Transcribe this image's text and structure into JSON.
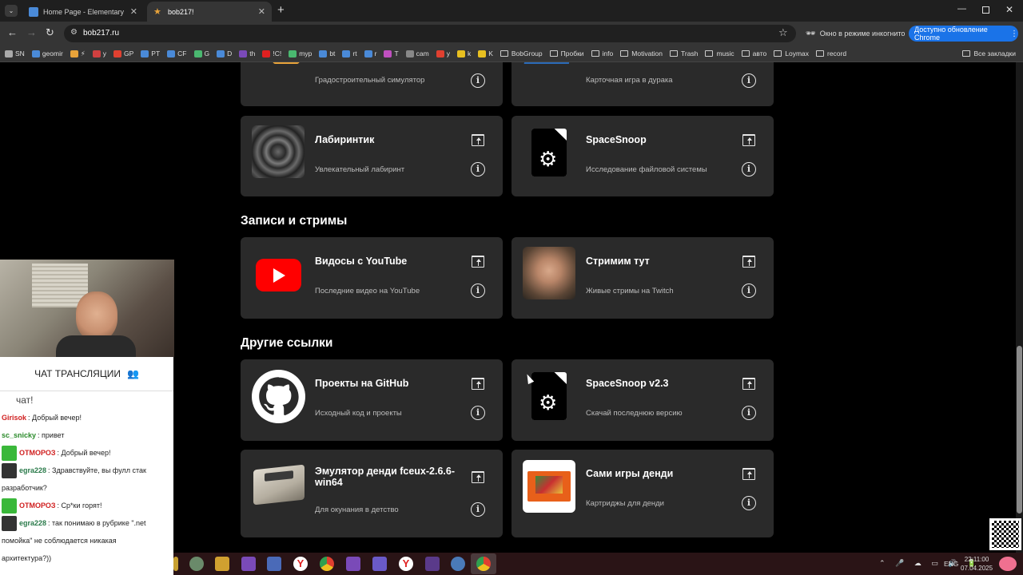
{
  "browser": {
    "tabs": [
      {
        "title": "Home Page - Elementary"
      },
      {
        "title": "bob217!"
      }
    ],
    "url": "bob217.ru",
    "incognito_label": "Окно в режиме инкогнито",
    "update_label": "Доступно обновление Chrome",
    "bookmarks": [
      "SN",
      "geomir",
      "⚡",
      "y",
      "GP",
      "PT",
      "CF",
      "G",
      "D",
      "th",
      "!C!",
      "myp",
      "bt",
      "rt",
      "r",
      "T",
      "cam",
      "y",
      "k",
      "K",
      "BobGroup",
      "Пробки",
      "info",
      "Motivation",
      "Trash",
      "music",
      "авто",
      "Loymax",
      "record"
    ],
    "all_bookmarks": "Все закладки"
  },
  "page": {
    "top_cards": [
      {
        "desc": "Градостроительный симулятор"
      },
      {
        "desc": "Карточная игра в дурака"
      }
    ],
    "row2": [
      {
        "title": "Лабиринтик",
        "desc": "Увлекательный лабиринт"
      },
      {
        "title": "SpaceSnoop",
        "desc": "Исследование файловой системы"
      }
    ],
    "section_streams": "Записи и стримы",
    "streams": [
      {
        "title": "Видосы с YouTube",
        "desc": "Последние видео на YouTube"
      },
      {
        "title": "Стримим тут",
        "desc": "Живые стримы на Twitch"
      }
    ],
    "section_other": "Другие ссылки",
    "other": [
      {
        "title": "Проекты на GitHub",
        "desc": "Исходный код и проекты"
      },
      {
        "title": "SpaceSnoop v2.3",
        "desc": "Скачай последнюю версию"
      },
      {
        "title": "Эмулятор денди fceux-2.6.6-win64",
        "desc": "Для окунания в детство"
      },
      {
        "title": "Сами игры денди",
        "desc": "Картриджы для денди"
      }
    ]
  },
  "chat": {
    "header": "ЧАТ ТРАНСЛЯЦИИ",
    "messages": [
      {
        "user": "",
        "text": "чат!"
      },
      {
        "user": "Girisok",
        "text": ": Добрый вечер!"
      },
      {
        "user": "sc_snicky",
        "text": ": привет"
      },
      {
        "user": "ОТМОРОЗ",
        "text": ": Добрый вечер!"
      },
      {
        "user": "egra228",
        "text": ": Здравствуйте, вы фулл стак"
      },
      {
        "user": "",
        "text": "разработчик?"
      },
      {
        "user": "ОТМОРОЗ",
        "text": ": Ср*ки горят!"
      },
      {
        "user": "egra228",
        "text": ": так понимаю в рубрике \".net"
      },
      {
        "user": "",
        "text": "помойка\" не соблюдается никакая"
      },
      {
        "user": "",
        "text": "архитектура?))"
      }
    ]
  },
  "tray": {
    "lang": "ENG",
    "time": "22:11:00",
    "date": "07.04.2025"
  },
  "colors": {
    "page_bg": "#000000",
    "card_bg": "#2a2a2a",
    "chrome_bg": "#353535",
    "update_btn": "#1a73e8",
    "youtube_red": "#ff0000"
  }
}
